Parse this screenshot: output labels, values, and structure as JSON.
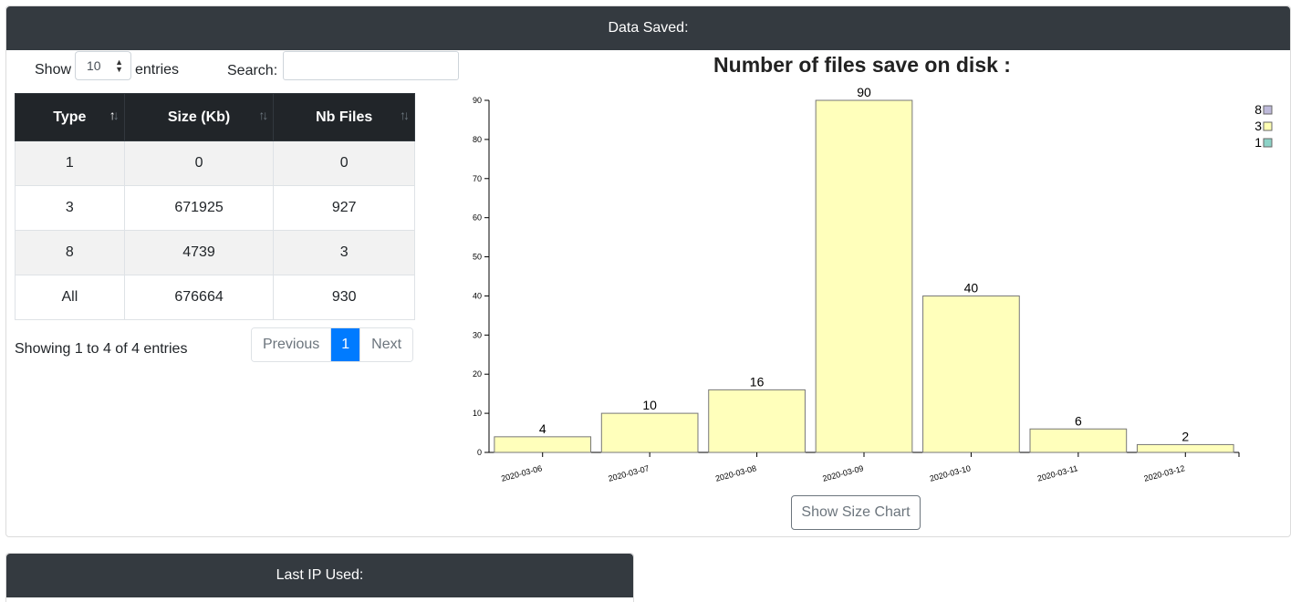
{
  "panel_saved": {
    "header": "Data Saved:",
    "length": {
      "show_label": "Show",
      "value": "10",
      "entries_label": "entries"
    },
    "search": {
      "label": "Search:",
      "value": ""
    },
    "table": {
      "columns": [
        "Type",
        "Size (Kb)",
        "Nb Files"
      ],
      "rows": [
        [
          "1",
          "0",
          "0"
        ],
        [
          "3",
          "671925",
          "927"
        ],
        [
          "8",
          "4739",
          "3"
        ],
        [
          "All",
          "676664",
          "930"
        ]
      ]
    },
    "info": "Showing 1 to 4 of 4 entries",
    "pagination": {
      "previous": "Previous",
      "current": "1",
      "next": "Next"
    },
    "chart_button": "Show Size Chart"
  },
  "panel_ip": {
    "header": "Last IP Used:"
  },
  "colors": {
    "header_bg": "#343a40",
    "bar_fill": "#ffffbb",
    "page_active": "#007bff"
  },
  "chart_data": {
    "type": "bar",
    "title": "Number of files save on disk :",
    "categories": [
      "2020-03-06",
      "2020-03-07",
      "2020-03-08",
      "2020-03-09",
      "2020-03-10",
      "2020-03-11",
      "2020-03-12"
    ],
    "series": [
      {
        "name": "8",
        "color": "#bebada",
        "values": [
          0,
          0,
          0,
          0,
          0,
          0,
          0
        ]
      },
      {
        "name": "3",
        "color": "#ffffb3",
        "values": [
          4,
          10,
          16,
          90,
          40,
          6,
          2
        ]
      },
      {
        "name": "1",
        "color": "#8dd3c7",
        "values": [
          0,
          0,
          0,
          0,
          0,
          0,
          0
        ]
      }
    ],
    "data_labels": [
      "4",
      "10",
      "16",
      "90",
      "40",
      "6",
      "2"
    ],
    "yticks": [
      0,
      10,
      20,
      30,
      40,
      50,
      60,
      70,
      80,
      90
    ],
    "ylim": [
      0,
      90
    ],
    "legend_position": "top-right"
  }
}
